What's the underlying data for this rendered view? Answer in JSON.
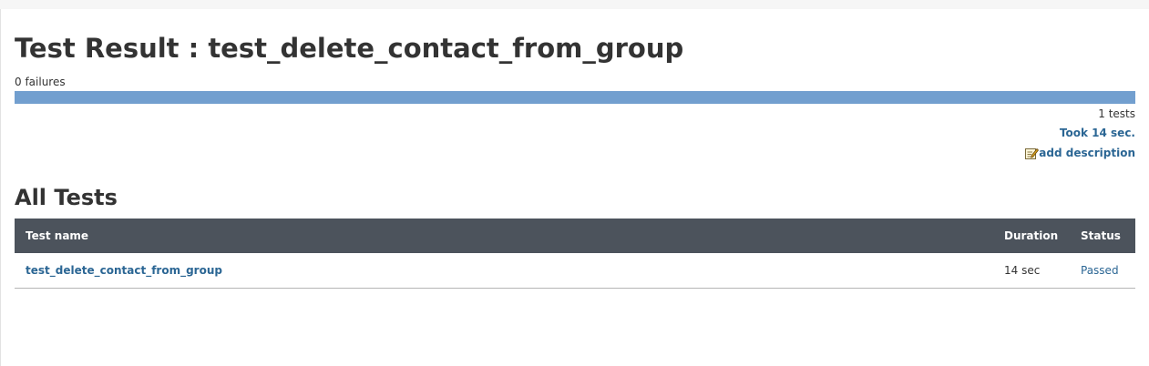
{
  "page": {
    "title": "Test Result : test_delete_contact_from_group",
    "failures_text": "0 failures",
    "progress_fraction": 1.0,
    "colors": {
      "progress_fill": "#729fcf",
      "link": "#2b6694",
      "table_header_bg": "#4c535c"
    }
  },
  "summary": {
    "tests_count": "1 tests",
    "took": "Took 14 sec.",
    "add_description": "add description",
    "add_description_icon": "edit-note-icon"
  },
  "all_tests": {
    "heading": "All Tests",
    "columns": [
      "Test name",
      "Duration",
      "Status"
    ],
    "rows": [
      {
        "name": "test_delete_contact_from_group",
        "duration": "14 sec",
        "status": "Passed"
      }
    ]
  }
}
